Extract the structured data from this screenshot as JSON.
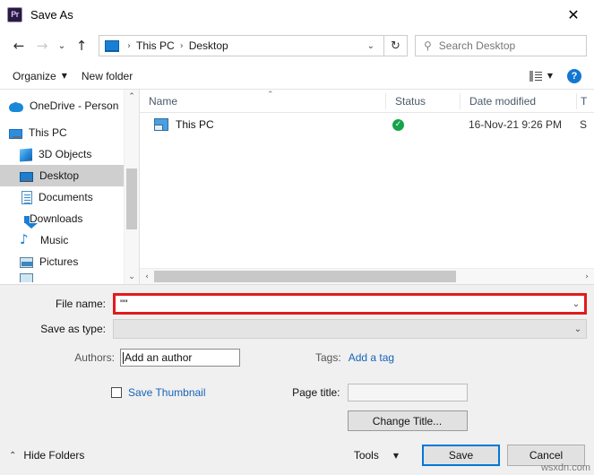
{
  "window": {
    "title": "Save As",
    "app_icon": "Pr",
    "close_icon": "✕"
  },
  "addressbar": {
    "back_icon": "←",
    "forward_icon": "→",
    "recent_icon": "⌄",
    "up_icon": "↑",
    "pc_icon": "this-pc-icon",
    "breadcrumbs": [
      "This PC",
      "Desktop"
    ],
    "separator": "›",
    "dropdown_icon": "⌄",
    "refresh_icon": "↻",
    "search_icon": "⚲",
    "search_placeholder": "Search Desktop"
  },
  "commandbar": {
    "organize_label": "Organize",
    "organize_caret": "▼",
    "new_folder_label": "New folder",
    "view_caret": "▼",
    "help_label": "?"
  },
  "sidebar": {
    "items": [
      {
        "label": "OneDrive - Person",
        "icon": "cloud-icon",
        "selected": false,
        "indent": false
      },
      {
        "label": "This PC",
        "icon": "monitor-icon",
        "selected": false,
        "indent": false
      },
      {
        "label": "3D Objects",
        "icon": "cube-icon",
        "selected": false,
        "indent": true
      },
      {
        "label": "Desktop",
        "icon": "desktop-icon",
        "selected": true,
        "indent": true
      },
      {
        "label": "Documents",
        "icon": "document-icon",
        "selected": false,
        "indent": true
      },
      {
        "label": "Downloads",
        "icon": "download-icon",
        "selected": false,
        "indent": true
      },
      {
        "label": "Music",
        "icon": "music-note-icon",
        "selected": false,
        "indent": true
      },
      {
        "label": "Pictures",
        "icon": "picture-icon",
        "selected": false,
        "indent": true
      }
    ],
    "scroll_up_icon": "⌃",
    "scroll_down_icon": "⌄"
  },
  "filelist": {
    "columns": [
      "Name",
      "Status",
      "Date modified",
      "T"
    ],
    "sort_caret": "⌃",
    "rows": [
      {
        "name": "This PC",
        "status_icon": "✓",
        "date_modified": "16-Nov-21 9:26 PM",
        "size": "S"
      }
    ],
    "hscroll_left_icon": "‹",
    "hscroll_right_icon": "›"
  },
  "form": {
    "filename_label": "File name:",
    "filename_value": "\"\"",
    "filename_caret": "⌄",
    "savetype_label": "Save as type:",
    "savetype_value": "",
    "savetype_caret": "⌄",
    "authors_label": "Authors:",
    "authors_value": "Add an author",
    "tags_label": "Tags:",
    "tags_link": "Add a tag",
    "save_thumbnail_label": "Save Thumbnail",
    "page_title_label": "Page title:",
    "page_title_value": "",
    "change_title_label": "Change Title..."
  },
  "footer": {
    "hide_folders_label": "Hide Folders",
    "hide_folders_caret": "⌃",
    "tools_label": "Tools",
    "tools_caret": "▼",
    "save_label": "Save",
    "cancel_label": "Cancel"
  },
  "watermark": "wsxdn.com",
  "colors": {
    "accent": "#0078d7",
    "highlight_border": "#e21b1b",
    "link": "#1763b8",
    "status_ok": "#16a34a"
  }
}
